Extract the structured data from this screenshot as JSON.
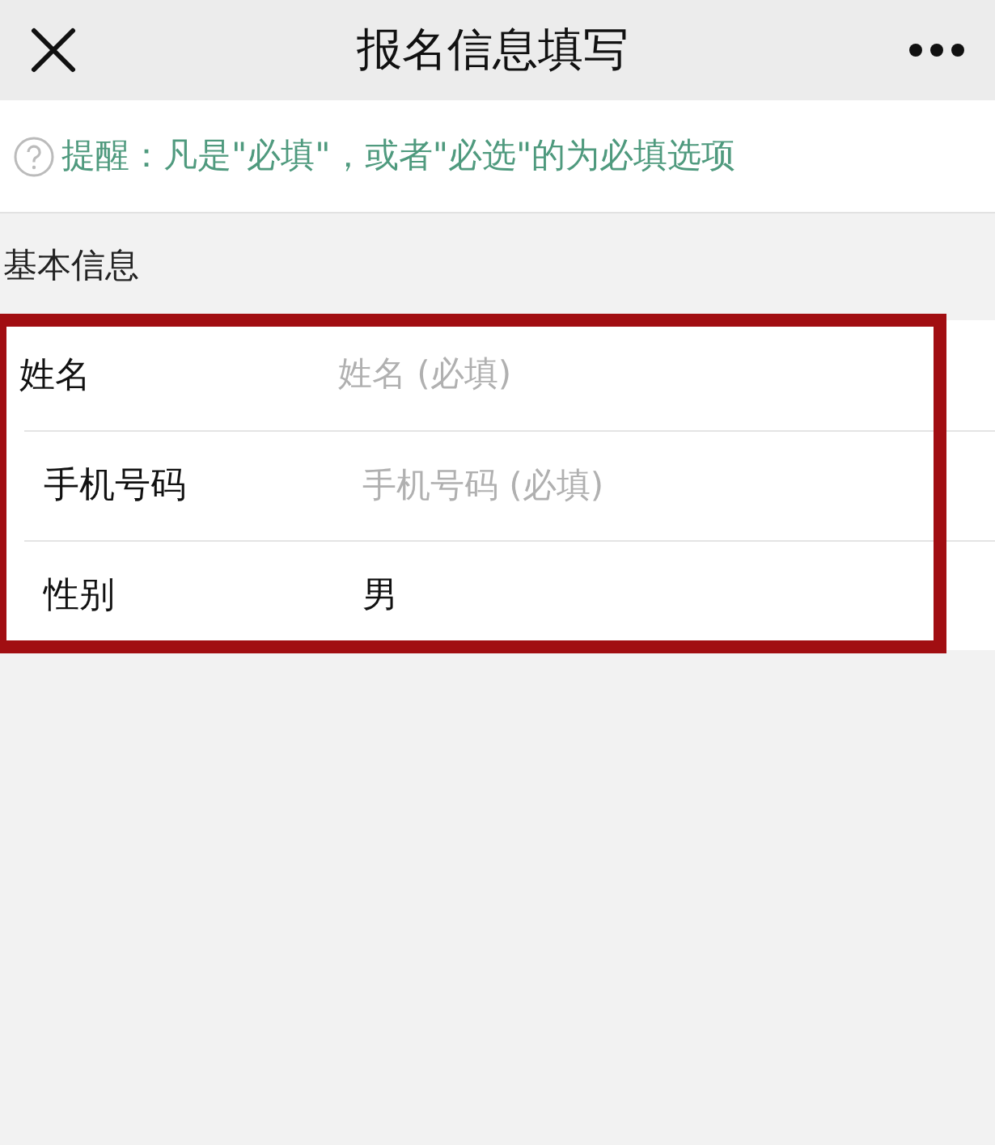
{
  "nav_bar": {
    "title": "报名信息填写"
  },
  "notice": {
    "text": "提醒：凡是\"必填\"，或者\"必选\"的为必填选项"
  },
  "section": {
    "title": "基本信息"
  },
  "fields": [
    {
      "label": "姓名",
      "kind": "text",
      "placeholder": "姓名 (必填)"
    },
    {
      "label": "手机号码",
      "kind": "text",
      "placeholder": "手机号码 (必填)"
    },
    {
      "label": "性别",
      "kind": "select",
      "value": "男"
    }
  ]
}
